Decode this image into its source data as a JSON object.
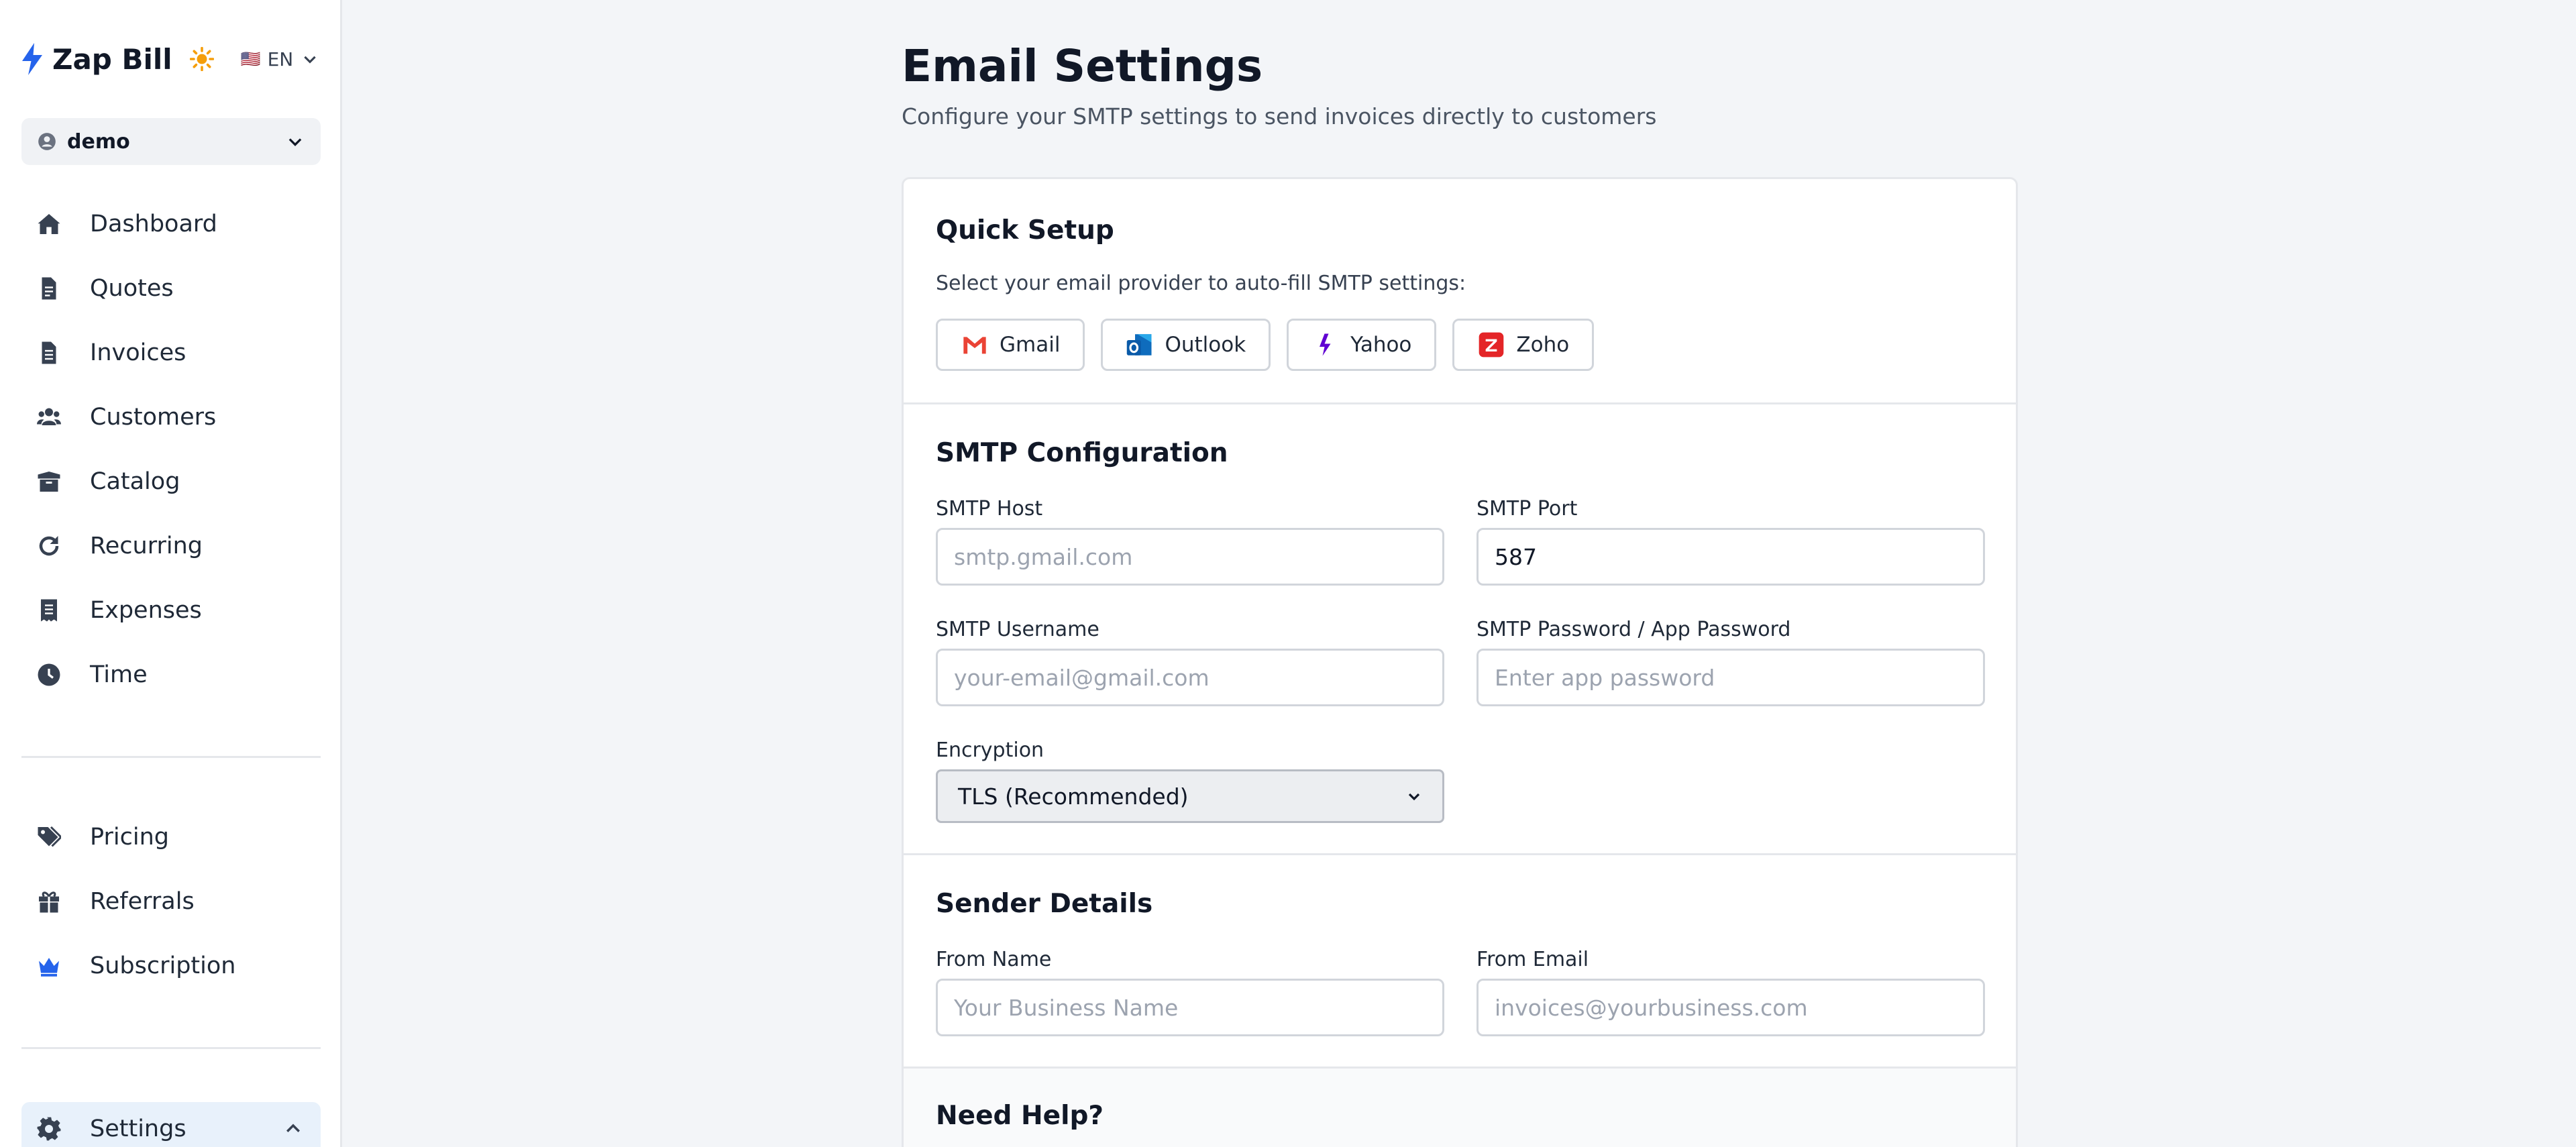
{
  "brand": {
    "name": "Zap Bill",
    "lang": "EN",
    "flag": "🇺🇸"
  },
  "colors": {
    "accent": "#2563eb",
    "theme_sun": "#f59e0b",
    "gmail": "#ea4335",
    "outlook": "#0f6cbd",
    "yahoo": "#6001d2",
    "zoho": "#e42527"
  },
  "user": {
    "name": "demo"
  },
  "sidebar": {
    "items": [
      {
        "label": "Dashboard",
        "icon": "home-icon"
      },
      {
        "label": "Quotes",
        "icon": "document-icon"
      },
      {
        "label": "Invoices",
        "icon": "invoice-icon"
      },
      {
        "label": "Customers",
        "icon": "users-icon"
      },
      {
        "label": "Catalog",
        "icon": "box-icon"
      },
      {
        "label": "Recurring",
        "icon": "refresh-icon"
      },
      {
        "label": "Expenses",
        "icon": "receipt-icon"
      },
      {
        "label": "Time",
        "icon": "clock-icon"
      }
    ],
    "items2": [
      {
        "label": "Pricing",
        "icon": "tags-icon"
      },
      {
        "label": "Referrals",
        "icon": "gift-icon"
      },
      {
        "label": "Subscription",
        "icon": "crown-icon"
      }
    ],
    "settings": {
      "label": "Settings",
      "icon": "gear-icon"
    }
  },
  "page": {
    "title": "Email Settings",
    "subtitle": "Configure your SMTP settings to send invoices directly to customers"
  },
  "quick_setup": {
    "title": "Quick Setup",
    "helper": "Select your email provider to auto-fill SMTP settings:",
    "providers": [
      "Gmail",
      "Outlook",
      "Yahoo",
      "Zoho"
    ]
  },
  "smtp": {
    "title": "SMTP Configuration",
    "host_label": "SMTP Host",
    "host_placeholder": "smtp.gmail.com",
    "port_label": "SMTP Port",
    "port_value": "587",
    "username_label": "SMTP Username",
    "username_placeholder": "your-email@gmail.com",
    "password_label": "SMTP Password / App Password",
    "password_placeholder": "Enter app password",
    "encryption_label": "Encryption",
    "encryption_value": "TLS (Recommended)"
  },
  "sender": {
    "title": "Sender Details",
    "from_name_label": "From Name",
    "from_name_placeholder": "Your Business Name",
    "from_email_label": "From Email",
    "from_email_placeholder": "invoices@yourbusiness.com"
  },
  "help": {
    "title": "Need Help?"
  }
}
